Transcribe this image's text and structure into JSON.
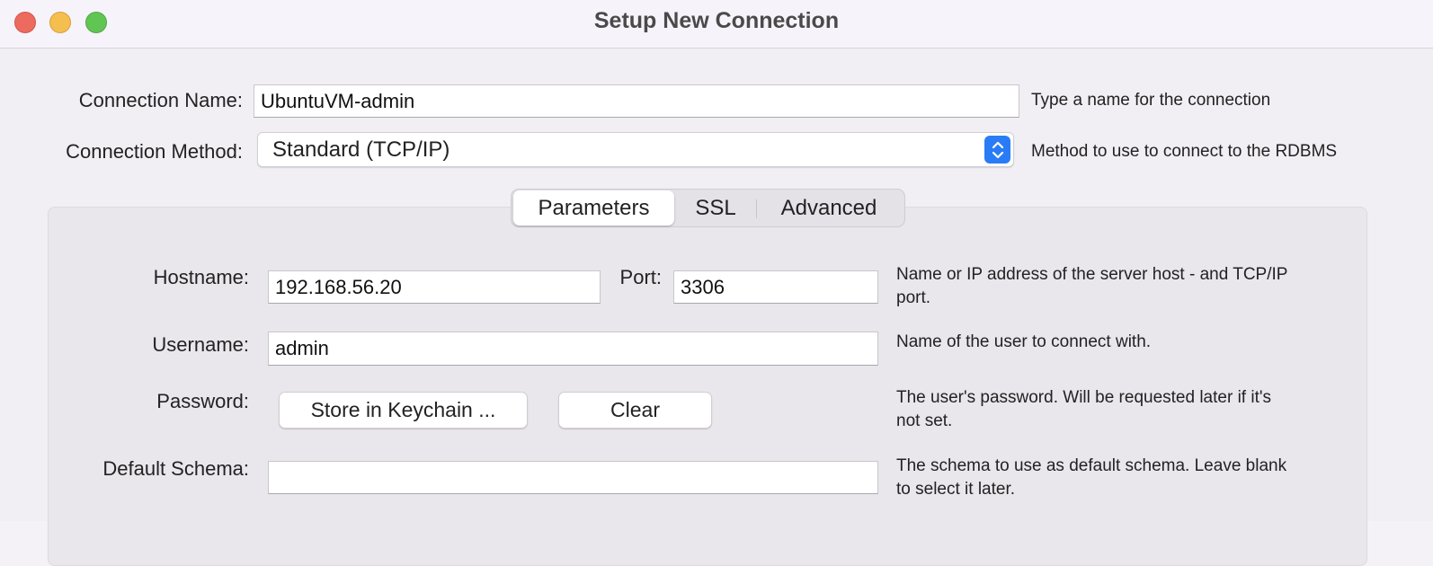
{
  "window": {
    "title": "Setup New Connection"
  },
  "connection_name": {
    "label": "Connection Name:",
    "value": "UbuntuVM-admin",
    "hint": "Type a name for the connection"
  },
  "connection_method": {
    "label": "Connection Method:",
    "value": "Standard (TCP/IP)",
    "hint": "Method to use to connect to the RDBMS"
  },
  "tabs": [
    {
      "label": "Parameters",
      "active": true
    },
    {
      "label": "SSL",
      "active": false
    },
    {
      "label": "Advanced",
      "active": false
    }
  ],
  "parameters": {
    "hostname": {
      "label": "Hostname:",
      "value": "192.168.56.20"
    },
    "port": {
      "label": "Port:",
      "value": "3306"
    },
    "host_hint_line1": "Name or IP address of the server host - and TCP/IP",
    "host_hint_line2": "port.",
    "username": {
      "label": "Username:",
      "value": "admin",
      "hint": "Name of the user to connect with."
    },
    "password": {
      "label": "Password:",
      "store_button": "Store in Keychain ...",
      "clear_button": "Clear",
      "hint_line1": "The user's password. Will be requested later if it's",
      "hint_line2": "not set."
    },
    "default_schema": {
      "label": "Default Schema:",
      "value": "",
      "hint_line1": "The schema to use as default schema. Leave blank",
      "hint_line2": "to select it later."
    }
  }
}
